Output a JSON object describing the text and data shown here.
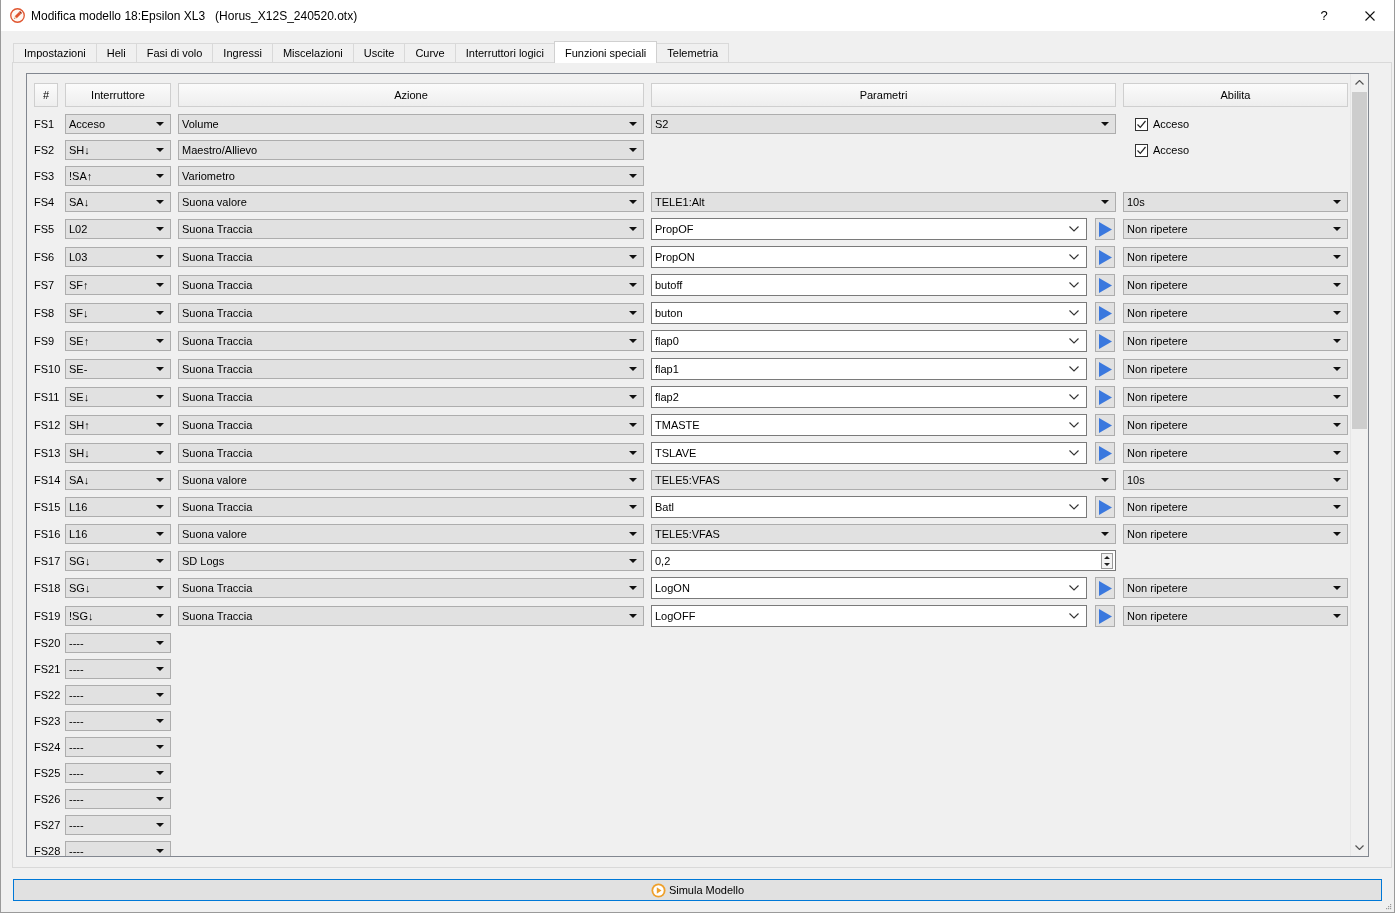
{
  "window": {
    "title": "Modifica modello 18:Epsilon XL3",
    "file": "(Horus_X12S_240520.otx)",
    "help": "?"
  },
  "tabs": [
    {
      "label": "Impostazioni",
      "selected": false
    },
    {
      "label": "Heli",
      "selected": false
    },
    {
      "label": "Fasi di volo",
      "selected": false
    },
    {
      "label": "Ingressi",
      "selected": false
    },
    {
      "label": "Miscelazioni",
      "selected": false
    },
    {
      "label": "Uscite",
      "selected": false
    },
    {
      "label": "Curve",
      "selected": false
    },
    {
      "label": "Interruttori logici",
      "selected": false
    },
    {
      "label": "Funzioni speciali",
      "selected": true
    },
    {
      "label": "Telemetria",
      "selected": false
    }
  ],
  "table": {
    "columns": [
      "#",
      "Interruttore",
      "Azione",
      "Parametri",
      "Abilita"
    ],
    "rows": [
      {
        "label": "FS1",
        "switch": "Acceso",
        "action": "Volume",
        "param": {
          "kind": "combo",
          "value": "S2"
        },
        "enable": {
          "kind": "checkbox",
          "label": "Acceso",
          "checked": true
        }
      },
      {
        "label": "FS2",
        "switch": "SH↓",
        "action": "Maestro/Allievo",
        "enable": {
          "kind": "checkbox",
          "label": "Acceso",
          "checked": true
        }
      },
      {
        "label": "FS3",
        "switch": "!SA↑",
        "action": "Variometro"
      },
      {
        "label": "FS4",
        "switch": "SA↓",
        "action": "Suona valore",
        "param": {
          "kind": "combo",
          "value": "TELE1:Alt"
        },
        "enable": {
          "kind": "combo",
          "value": "10s"
        }
      },
      {
        "label": "FS5",
        "switch": "L02",
        "action": "Suona Traccia",
        "param": {
          "kind": "track",
          "value": "PropOF"
        },
        "enable": {
          "kind": "combo",
          "value": "Non ripetere"
        }
      },
      {
        "label": "FS6",
        "switch": "L03",
        "action": "Suona Traccia",
        "param": {
          "kind": "track",
          "value": "PropON"
        },
        "enable": {
          "kind": "combo",
          "value": "Non ripetere"
        }
      },
      {
        "label": "FS7",
        "switch": "SF↑",
        "action": "Suona Traccia",
        "param": {
          "kind": "track",
          "value": "butoff"
        },
        "enable": {
          "kind": "combo",
          "value": "Non ripetere"
        }
      },
      {
        "label": "FS8",
        "switch": "SF↓",
        "action": "Suona Traccia",
        "param": {
          "kind": "track",
          "value": "buton"
        },
        "enable": {
          "kind": "combo",
          "value": "Non ripetere"
        }
      },
      {
        "label": "FS9",
        "switch": "SE↑",
        "action": "Suona Traccia",
        "param": {
          "kind": "track",
          "value": "flap0"
        },
        "enable": {
          "kind": "combo",
          "value": "Non ripetere"
        }
      },
      {
        "label": "FS10",
        "switch": "SE-",
        "action": "Suona Traccia",
        "param": {
          "kind": "track",
          "value": "flap1"
        },
        "enable": {
          "kind": "combo",
          "value": "Non ripetere"
        }
      },
      {
        "label": "FS11",
        "switch": "SE↓",
        "action": "Suona Traccia",
        "param": {
          "kind": "track",
          "value": "flap2"
        },
        "enable": {
          "kind": "combo",
          "value": "Non ripetere"
        }
      },
      {
        "label": "FS12",
        "switch": "SH↑",
        "action": "Suona Traccia",
        "param": {
          "kind": "track",
          "value": "TMASTE"
        },
        "enable": {
          "kind": "combo",
          "value": "Non ripetere"
        }
      },
      {
        "label": "FS13",
        "switch": "SH↓",
        "action": "Suona Traccia",
        "param": {
          "kind": "track",
          "value": "TSLAVE"
        },
        "enable": {
          "kind": "combo",
          "value": "Non ripetere"
        }
      },
      {
        "label": "FS14",
        "switch": "SA↓",
        "action": "Suona valore",
        "param": {
          "kind": "combo",
          "value": "TELE5:VFAS"
        },
        "enable": {
          "kind": "combo",
          "value": "10s"
        }
      },
      {
        "label": "FS15",
        "switch": "L16",
        "action": "Suona Traccia",
        "param": {
          "kind": "track",
          "value": "Batl"
        },
        "enable": {
          "kind": "combo",
          "value": "Non ripetere"
        }
      },
      {
        "label": "FS16",
        "switch": "L16",
        "action": "Suona valore",
        "param": {
          "kind": "combo",
          "value": "TELE5:VFAS"
        },
        "enable": {
          "kind": "combo",
          "value": "Non ripetere"
        }
      },
      {
        "label": "FS17",
        "switch": "SG↓",
        "action": "SD Logs",
        "param": {
          "kind": "spin",
          "value": "0,2"
        }
      },
      {
        "label": "FS18",
        "switch": "SG↓",
        "action": "Suona Traccia",
        "param": {
          "kind": "track",
          "value": "LogON"
        },
        "enable": {
          "kind": "combo",
          "value": "Non ripetere"
        }
      },
      {
        "label": "FS19",
        "switch": "!SG↓",
        "action": "Suona Traccia",
        "param": {
          "kind": "track",
          "value": "LogOFF"
        },
        "enable": {
          "kind": "combo",
          "value": "Non ripetere"
        }
      },
      {
        "label": "FS20",
        "switch": "----"
      },
      {
        "label": "FS21",
        "switch": "----"
      },
      {
        "label": "FS22",
        "switch": "----"
      },
      {
        "label": "FS23",
        "switch": "----"
      },
      {
        "label": "FS24",
        "switch": "----"
      },
      {
        "label": "FS25",
        "switch": "----"
      },
      {
        "label": "FS26",
        "switch": "----"
      },
      {
        "label": "FS27",
        "switch": "----"
      },
      {
        "label": "FS28",
        "switch": "----"
      }
    ]
  },
  "simulate_button": "Simula Modello"
}
